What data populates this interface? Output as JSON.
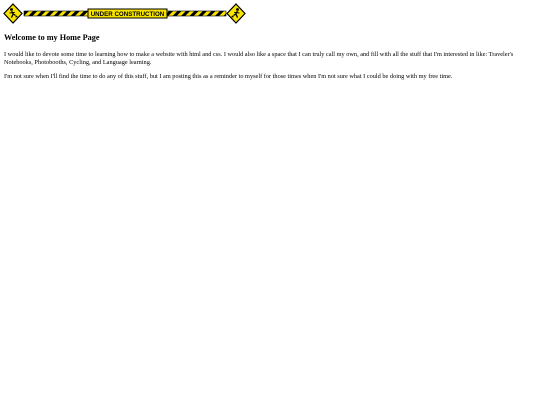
{
  "banner": {
    "text": "UNDER CONSTRUCTION",
    "colors": {
      "yellow": "#f7e400",
      "black": "#000000"
    }
  },
  "main": {
    "heading": "Welcome to my Home Page",
    "paragraphs": [
      "I would like to devote some time to learning how to make a website with html and css. I would also like a space that I can truly call my own, and fill with all the stuff that I'm interested in like: Traveler's Notebooks, Photobooths, Cycling, and Language learning.",
      "I'm not sure when I'll find the time to do any of this stuff, but I am posting this as a reminder to myself for those times when I'm not sure what I could be doing with my free time."
    ]
  }
}
